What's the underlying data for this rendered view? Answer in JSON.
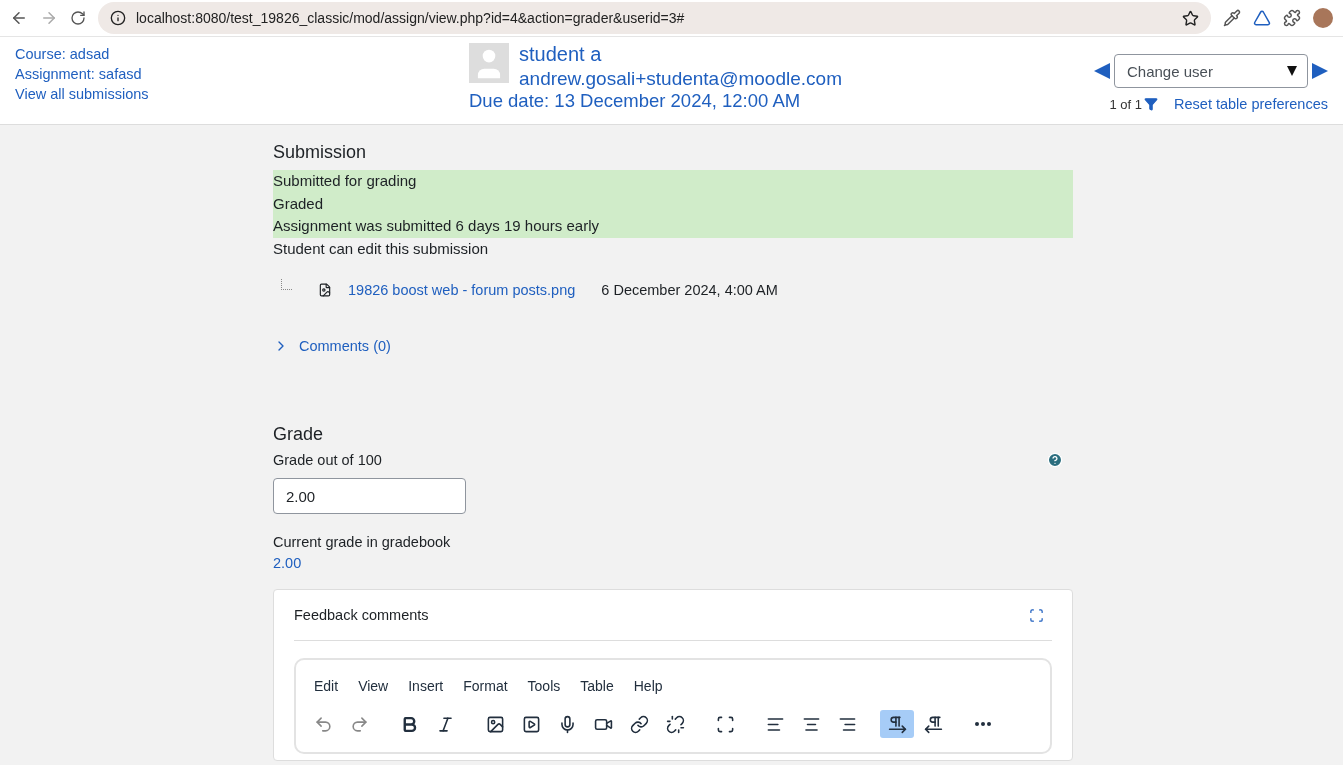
{
  "browser": {
    "url": "localhost:8080/test_19826_classic/mod/assign/view.php?id=4&action=grader&userid=3#"
  },
  "header": {
    "links": [
      "Course: adsad",
      "Assignment: safasd",
      "View all submissions"
    ],
    "user_name": "student a",
    "user_email": "andrew.gosali+studenta@moodle.com",
    "due_date": "Due date: 13 December 2024, 12:00 AM",
    "change_user": "Change user",
    "count": "1 of 1",
    "reset": "Reset table preferences"
  },
  "submission": {
    "title": "Submission",
    "statuses": [
      {
        "text": "Submitted for grading",
        "highlighted": true
      },
      {
        "text": "Graded",
        "highlighted": true
      },
      {
        "text": "Assignment was submitted 6 days 19 hours early",
        "highlighted": true
      },
      {
        "text": "Student can edit this submission",
        "highlighted": false
      }
    ],
    "file": {
      "name": "19826 boost web - forum posts.png",
      "date": "6 December 2024, 4:00 AM"
    },
    "comments": {
      "label": "Comments (0)",
      "expanded": false
    }
  },
  "grade": {
    "title": "Grade",
    "label": "Grade out of 100",
    "value": "2.00",
    "current_label": "Current grade in gradebook",
    "current_value": "2.00"
  },
  "feedback": {
    "title": "Feedback comments",
    "menu": [
      "Edit",
      "View",
      "Insert",
      "Format",
      "Tools",
      "Table",
      "Help"
    ],
    "toolbar_groups": [
      [
        {
          "kind": "undo",
          "disabled": true,
          "selected": false
        },
        {
          "kind": "redo",
          "disabled": true,
          "selected": false
        }
      ],
      [
        {
          "kind": "bold",
          "disabled": false,
          "selected": false
        },
        {
          "kind": "italic",
          "disabled": false,
          "selected": false
        }
      ],
      [
        {
          "kind": "image",
          "disabled": false,
          "selected": false
        },
        {
          "kind": "media",
          "disabled": false,
          "selected": false
        },
        {
          "kind": "mic",
          "disabled": false,
          "selected": false
        },
        {
          "kind": "video",
          "disabled": false,
          "selected": false
        },
        {
          "kind": "link",
          "disabled": false,
          "selected": false
        },
        {
          "kind": "unlink",
          "disabled": false,
          "selected": false
        }
      ],
      [
        {
          "kind": "fullscreen",
          "disabled": false,
          "selected": false
        }
      ],
      [
        {
          "kind": "align-left",
          "disabled": false,
          "selected": false
        },
        {
          "kind": "align-center",
          "disabled": false,
          "selected": false
        },
        {
          "kind": "align-right",
          "disabled": false,
          "selected": false
        }
      ],
      [
        {
          "kind": "ltr",
          "disabled": false,
          "selected": true
        },
        {
          "kind": "rtl",
          "disabled": false,
          "selected": false
        }
      ],
      [
        {
          "kind": "more",
          "disabled": false,
          "selected": false
        }
      ]
    ]
  }
}
